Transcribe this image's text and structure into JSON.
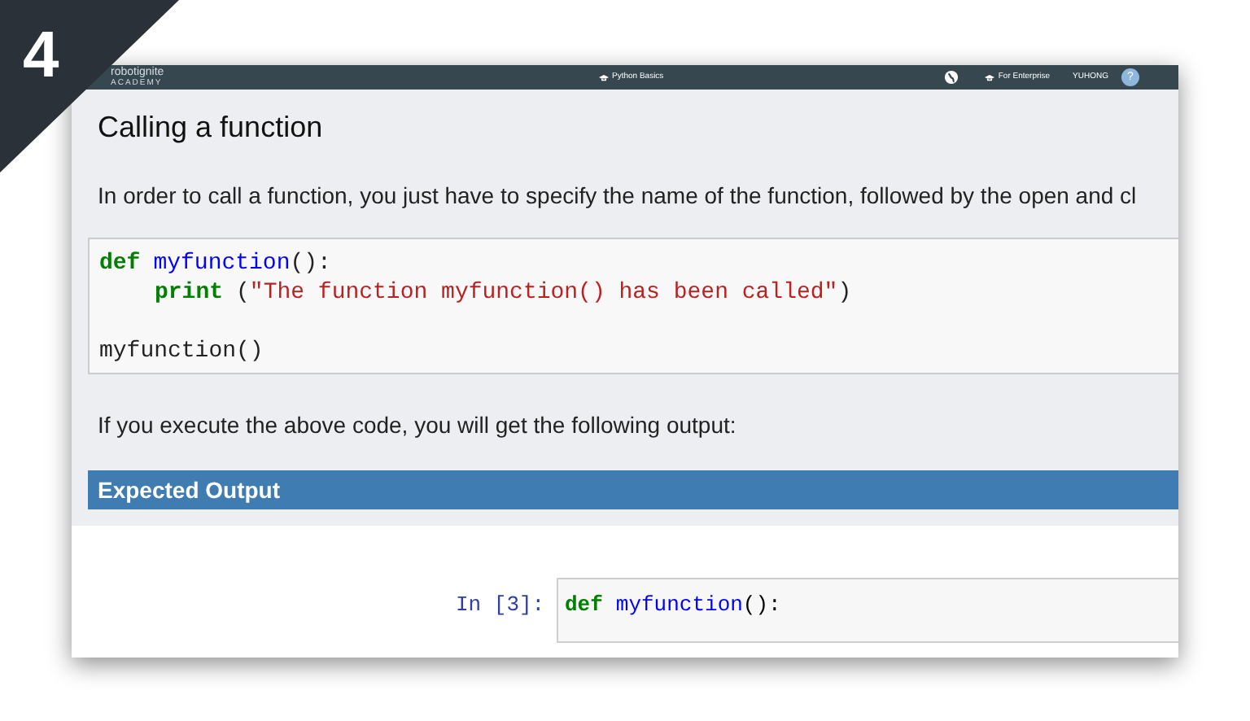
{
  "step_badge": "4",
  "navbar": {
    "logo": "robotignite",
    "logo_sub": "ACADEMY",
    "course": "Python Basics",
    "enterprise": "For Enterprise",
    "user": "YUHONG",
    "avatar": "?"
  },
  "title": "Calling a function",
  "intro": "In order to call a function, you just have to specify the name of the function, followed by the open and cl",
  "code_block": {
    "lines": [
      {
        "indent": false,
        "blank_before": false,
        "tokens": [
          {
            "kind": "keyword",
            "text": "def"
          },
          {
            "kind": "name",
            "text": "myfunction",
            "space_before": true
          },
          {
            "kind": "plain",
            "text": "():"
          }
        ]
      },
      {
        "indent": true,
        "blank_before": false,
        "tokens": [
          {
            "kind": "keyword",
            "text": "print"
          },
          {
            "kind": "plain",
            "text": "(",
            "space_before": true
          },
          {
            "kind": "string",
            "text": "\"The function myfunction() has been called\""
          },
          {
            "kind": "plain",
            "text": ")"
          }
        ]
      },
      {
        "indent": false,
        "blank_before": true,
        "tokens": [
          {
            "kind": "plain",
            "text": "myfunction()"
          }
        ]
      }
    ]
  },
  "output_intro": "If you execute the above code, you will get the following output:",
  "section_header": "Expected Output",
  "notebook_cell": {
    "prompt": "In [3]:",
    "lines": [
      {
        "indent": false,
        "blank_before": false,
        "tokens": [
          {
            "kind": "keyword",
            "text": "def"
          },
          {
            "kind": "name",
            "text": "myfunction",
            "space_before": true
          },
          {
            "kind": "plain",
            "text": "():"
          }
        ]
      }
    ]
  }
}
